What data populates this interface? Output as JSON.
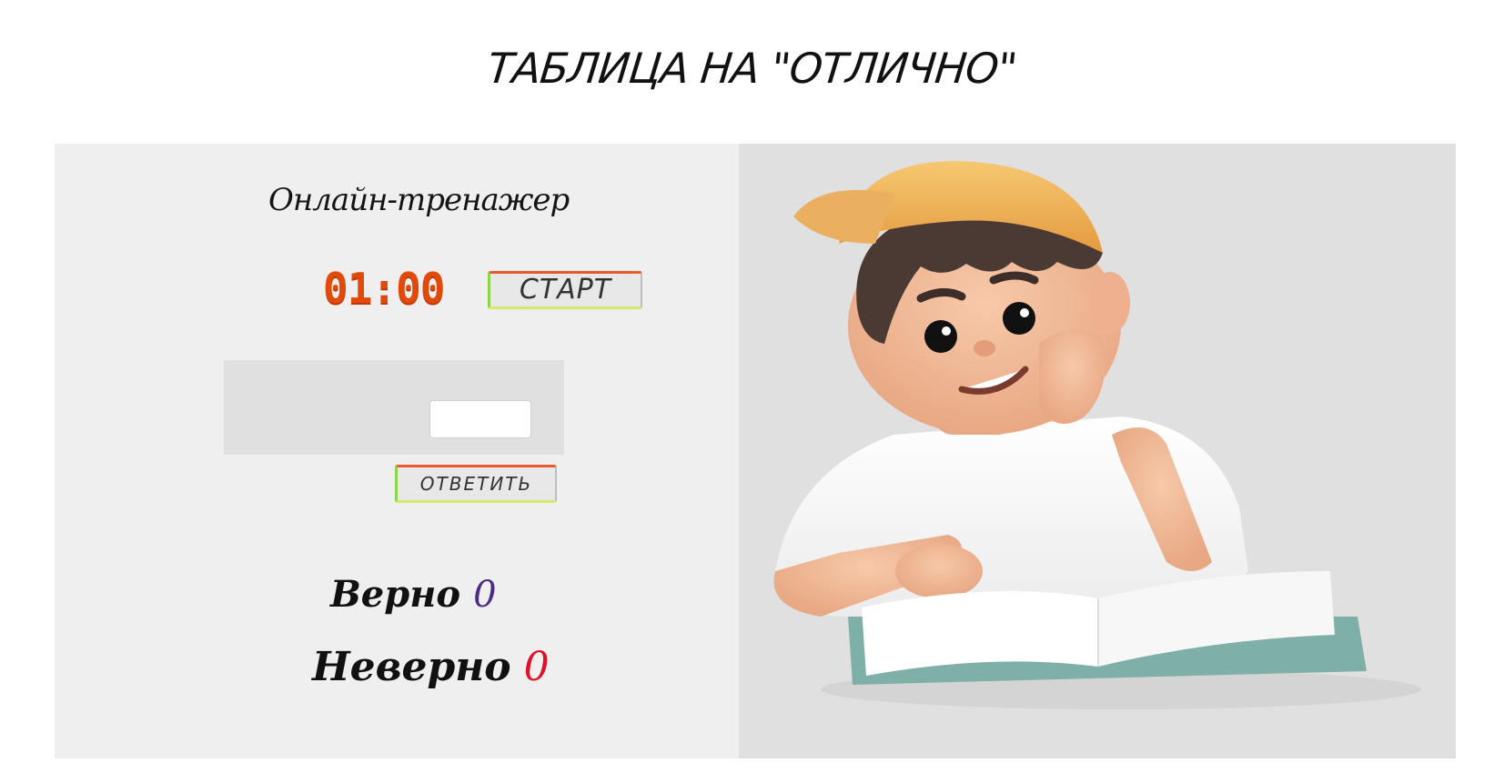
{
  "header": {
    "title": "ТАБЛИЦА НА \"ОТЛИЧНО\""
  },
  "trainer": {
    "subtitle": "Онлайн-тренажер",
    "timer": "01:00",
    "start_label": "СТАРТ",
    "answer_label": "ОТВЕТИТЬ",
    "answer_input": {
      "value": "",
      "placeholder": ""
    }
  },
  "stats": {
    "correct_label": "Верно",
    "correct_count": "0",
    "wrong_label": "Неверно",
    "wrong_count": "0"
  },
  "colors": {
    "left_panel": "#efefef",
    "right_panel": "#e0e0e0",
    "timer": "#e24a0a",
    "correct_count": "#4b2d86",
    "wrong_count": "#e0102a"
  },
  "illustration": {
    "icon": "boy-reading-book-illustration"
  }
}
